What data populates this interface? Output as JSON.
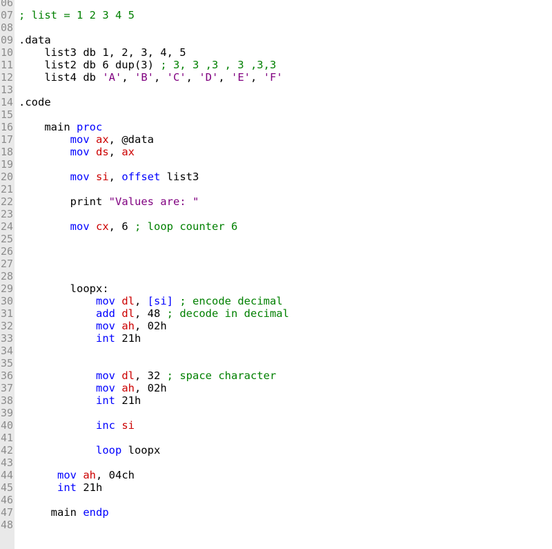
{
  "colors": {
    "keyword": "#0000ff",
    "register": "#cc0000",
    "comment": "#008000",
    "string": "#800080",
    "plain": "#000000",
    "gutter_bg": "#e9e9e9",
    "gutter_text": "#8c8c8c"
  },
  "gutter": [
    "06",
    "07",
    "08",
    "09",
    "10",
    "11",
    "12",
    "13",
    "14",
    "15",
    "16",
    "17",
    "18",
    "19",
    "20",
    "21",
    "22",
    "23",
    "24",
    "25",
    "26",
    "27",
    "28",
    "29",
    "30",
    "31",
    "32",
    "33",
    "34",
    "35",
    "36",
    "37",
    "38",
    "39",
    "40",
    "41",
    "42",
    "43",
    "44",
    "45",
    "46",
    "47",
    "48"
  ],
  "lines": [
    [],
    [
      {
        "t": "; list = 1 2 3 4 5",
        "c": "cm"
      }
    ],
    [],
    [
      {
        "t": ".data",
        "c": "pl"
      }
    ],
    [
      {
        "t": "    list3 db 1, 2, 3, 4, 5",
        "c": "pl"
      }
    ],
    [
      {
        "t": "    list2 db 6 dup(3) ",
        "c": "pl"
      },
      {
        "t": "; 3, 3 ,3 , 3 ,3,3",
        "c": "cm"
      }
    ],
    [
      {
        "t": "    list4 db ",
        "c": "pl"
      },
      {
        "t": "'A'",
        "c": "str"
      },
      {
        "t": ", ",
        "c": "pl"
      },
      {
        "t": "'B'",
        "c": "str"
      },
      {
        "t": ", ",
        "c": "pl"
      },
      {
        "t": "'C'",
        "c": "str"
      },
      {
        "t": ", ",
        "c": "pl"
      },
      {
        "t": "'D'",
        "c": "str"
      },
      {
        "t": ", ",
        "c": "pl"
      },
      {
        "t": "'E'",
        "c": "str"
      },
      {
        "t": ", ",
        "c": "pl"
      },
      {
        "t": "'F'",
        "c": "str"
      }
    ],
    [],
    [
      {
        "t": ".code",
        "c": "pl"
      }
    ],
    [],
    [
      {
        "t": "    main ",
        "c": "pl"
      },
      {
        "t": "proc",
        "c": "kw"
      }
    ],
    [
      {
        "t": "        ",
        "c": "pl"
      },
      {
        "t": "mov",
        "c": "kw"
      },
      {
        "t": " ",
        "c": "pl"
      },
      {
        "t": "ax",
        "c": "reg"
      },
      {
        "t": ", @data",
        "c": "pl"
      }
    ],
    [
      {
        "t": "        ",
        "c": "pl"
      },
      {
        "t": "mov",
        "c": "kw"
      },
      {
        "t": " ",
        "c": "pl"
      },
      {
        "t": "ds",
        "c": "reg"
      },
      {
        "t": ", ",
        "c": "pl"
      },
      {
        "t": "ax",
        "c": "reg"
      }
    ],
    [],
    [
      {
        "t": "        ",
        "c": "pl"
      },
      {
        "t": "mov",
        "c": "kw"
      },
      {
        "t": " ",
        "c": "pl"
      },
      {
        "t": "si",
        "c": "reg"
      },
      {
        "t": ", ",
        "c": "pl"
      },
      {
        "t": "offset",
        "c": "kw"
      },
      {
        "t": " list3",
        "c": "pl"
      }
    ],
    [],
    [
      {
        "t": "        print ",
        "c": "pl"
      },
      {
        "t": "\"Values are: \"",
        "c": "str"
      }
    ],
    [],
    [
      {
        "t": "        ",
        "c": "pl"
      },
      {
        "t": "mov",
        "c": "kw"
      },
      {
        "t": " ",
        "c": "pl"
      },
      {
        "t": "cx",
        "c": "reg"
      },
      {
        "t": ", 6 ",
        "c": "pl"
      },
      {
        "t": "; loop counter 6",
        "c": "cm"
      }
    ],
    [],
    [],
    [],
    [],
    [
      {
        "t": "        loopx:",
        "c": "pl"
      }
    ],
    [
      {
        "t": "            ",
        "c": "pl"
      },
      {
        "t": "mov",
        "c": "kw"
      },
      {
        "t": " ",
        "c": "pl"
      },
      {
        "t": "dl",
        "c": "reg"
      },
      {
        "t": ", ",
        "c": "pl"
      },
      {
        "t": "[si]",
        "c": "kw"
      },
      {
        "t": " ",
        "c": "pl"
      },
      {
        "t": "; encode decimal",
        "c": "cm"
      }
    ],
    [
      {
        "t": "            ",
        "c": "pl"
      },
      {
        "t": "add",
        "c": "kw"
      },
      {
        "t": " ",
        "c": "pl"
      },
      {
        "t": "dl",
        "c": "reg"
      },
      {
        "t": ", 48 ",
        "c": "pl"
      },
      {
        "t": "; decode in decimal",
        "c": "cm"
      }
    ],
    [
      {
        "t": "            ",
        "c": "pl"
      },
      {
        "t": "mov",
        "c": "kw"
      },
      {
        "t": " ",
        "c": "pl"
      },
      {
        "t": "ah",
        "c": "reg"
      },
      {
        "t": ", 02h",
        "c": "pl"
      }
    ],
    [
      {
        "t": "            ",
        "c": "pl"
      },
      {
        "t": "int",
        "c": "kw"
      },
      {
        "t": " 21h",
        "c": "pl"
      }
    ],
    [],
    [],
    [
      {
        "t": "            ",
        "c": "pl"
      },
      {
        "t": "mov",
        "c": "kw"
      },
      {
        "t": " ",
        "c": "pl"
      },
      {
        "t": "dl",
        "c": "reg"
      },
      {
        "t": ", 32 ",
        "c": "pl"
      },
      {
        "t": "; space character",
        "c": "cm"
      }
    ],
    [
      {
        "t": "            ",
        "c": "pl"
      },
      {
        "t": "mov",
        "c": "kw"
      },
      {
        "t": " ",
        "c": "pl"
      },
      {
        "t": "ah",
        "c": "reg"
      },
      {
        "t": ", 02h",
        "c": "pl"
      }
    ],
    [
      {
        "t": "            ",
        "c": "pl"
      },
      {
        "t": "int",
        "c": "kw"
      },
      {
        "t": " 21h",
        "c": "pl"
      }
    ],
    [],
    [
      {
        "t": "            ",
        "c": "pl"
      },
      {
        "t": "inc",
        "c": "kw"
      },
      {
        "t": " ",
        "c": "pl"
      },
      {
        "t": "si",
        "c": "reg"
      }
    ],
    [],
    [
      {
        "t": "            ",
        "c": "pl"
      },
      {
        "t": "loop",
        "c": "kw"
      },
      {
        "t": " loopx",
        "c": "pl"
      }
    ],
    [],
    [
      {
        "t": "      ",
        "c": "pl"
      },
      {
        "t": "mov",
        "c": "kw"
      },
      {
        "t": " ",
        "c": "pl"
      },
      {
        "t": "ah",
        "c": "reg"
      },
      {
        "t": ", 04ch",
        "c": "pl"
      }
    ],
    [
      {
        "t": "      ",
        "c": "pl"
      },
      {
        "t": "int",
        "c": "kw"
      },
      {
        "t": " 21h",
        "c": "pl"
      }
    ],
    [],
    [
      {
        "t": "     main ",
        "c": "pl"
      },
      {
        "t": "endp",
        "c": "kw"
      }
    ],
    []
  ]
}
